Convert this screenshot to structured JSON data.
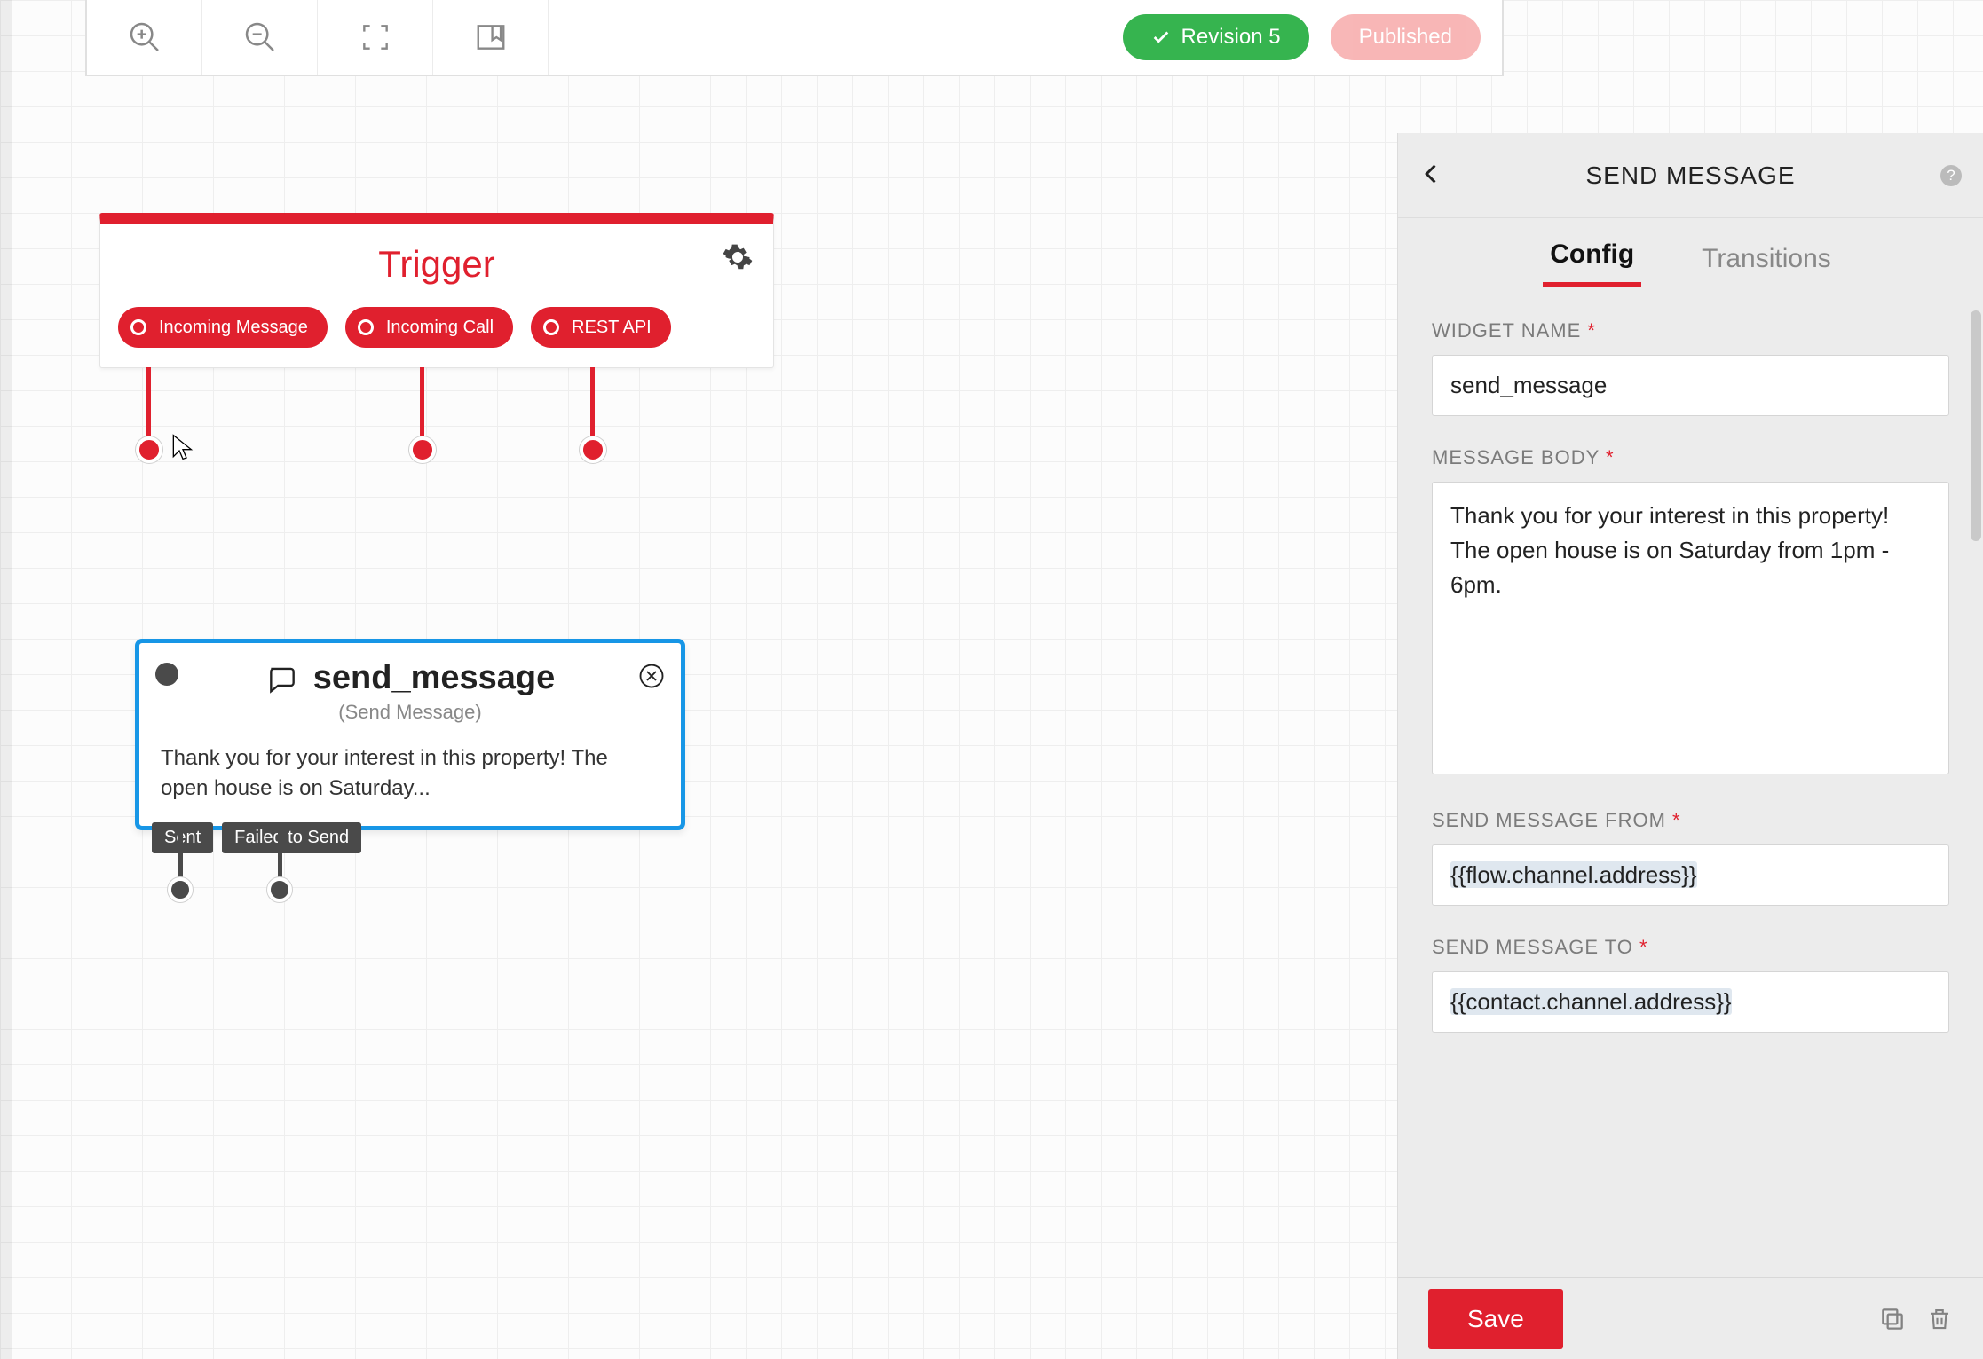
{
  "colors": {
    "accent_red": "#e0202e",
    "accent_blue": "#1796e6",
    "accent_green": "#36b44f"
  },
  "toolbar": {
    "revision_label": "Revision 5",
    "published_label": "Published"
  },
  "trigger": {
    "title": "Trigger",
    "pills": [
      "Incoming Message",
      "Incoming Call",
      "REST API"
    ]
  },
  "widget": {
    "name": "send_message",
    "type_label": "(Send Message)",
    "preview": "Thank you for your interest in this property! The open house is on Saturday...",
    "outputs": [
      "Sent",
      "Failed to Send"
    ]
  },
  "panel": {
    "title": "SEND MESSAGE",
    "tabs": {
      "config": "Config",
      "transitions": "Transitions"
    },
    "fields": {
      "widget_name_label": "WIDGET NAME",
      "widget_name_value": "send_message",
      "message_body_label": "MESSAGE BODY",
      "message_body_value": "Thank you for your interest in this property! The open house is on Saturday from 1pm - 6pm.",
      "send_from_label": "SEND MESSAGE FROM",
      "send_from_value": "{{flow.channel.address}}",
      "send_to_label": "SEND MESSAGE TO",
      "send_to_value": "{{contact.channel.address}}"
    },
    "save_label": "Save"
  }
}
